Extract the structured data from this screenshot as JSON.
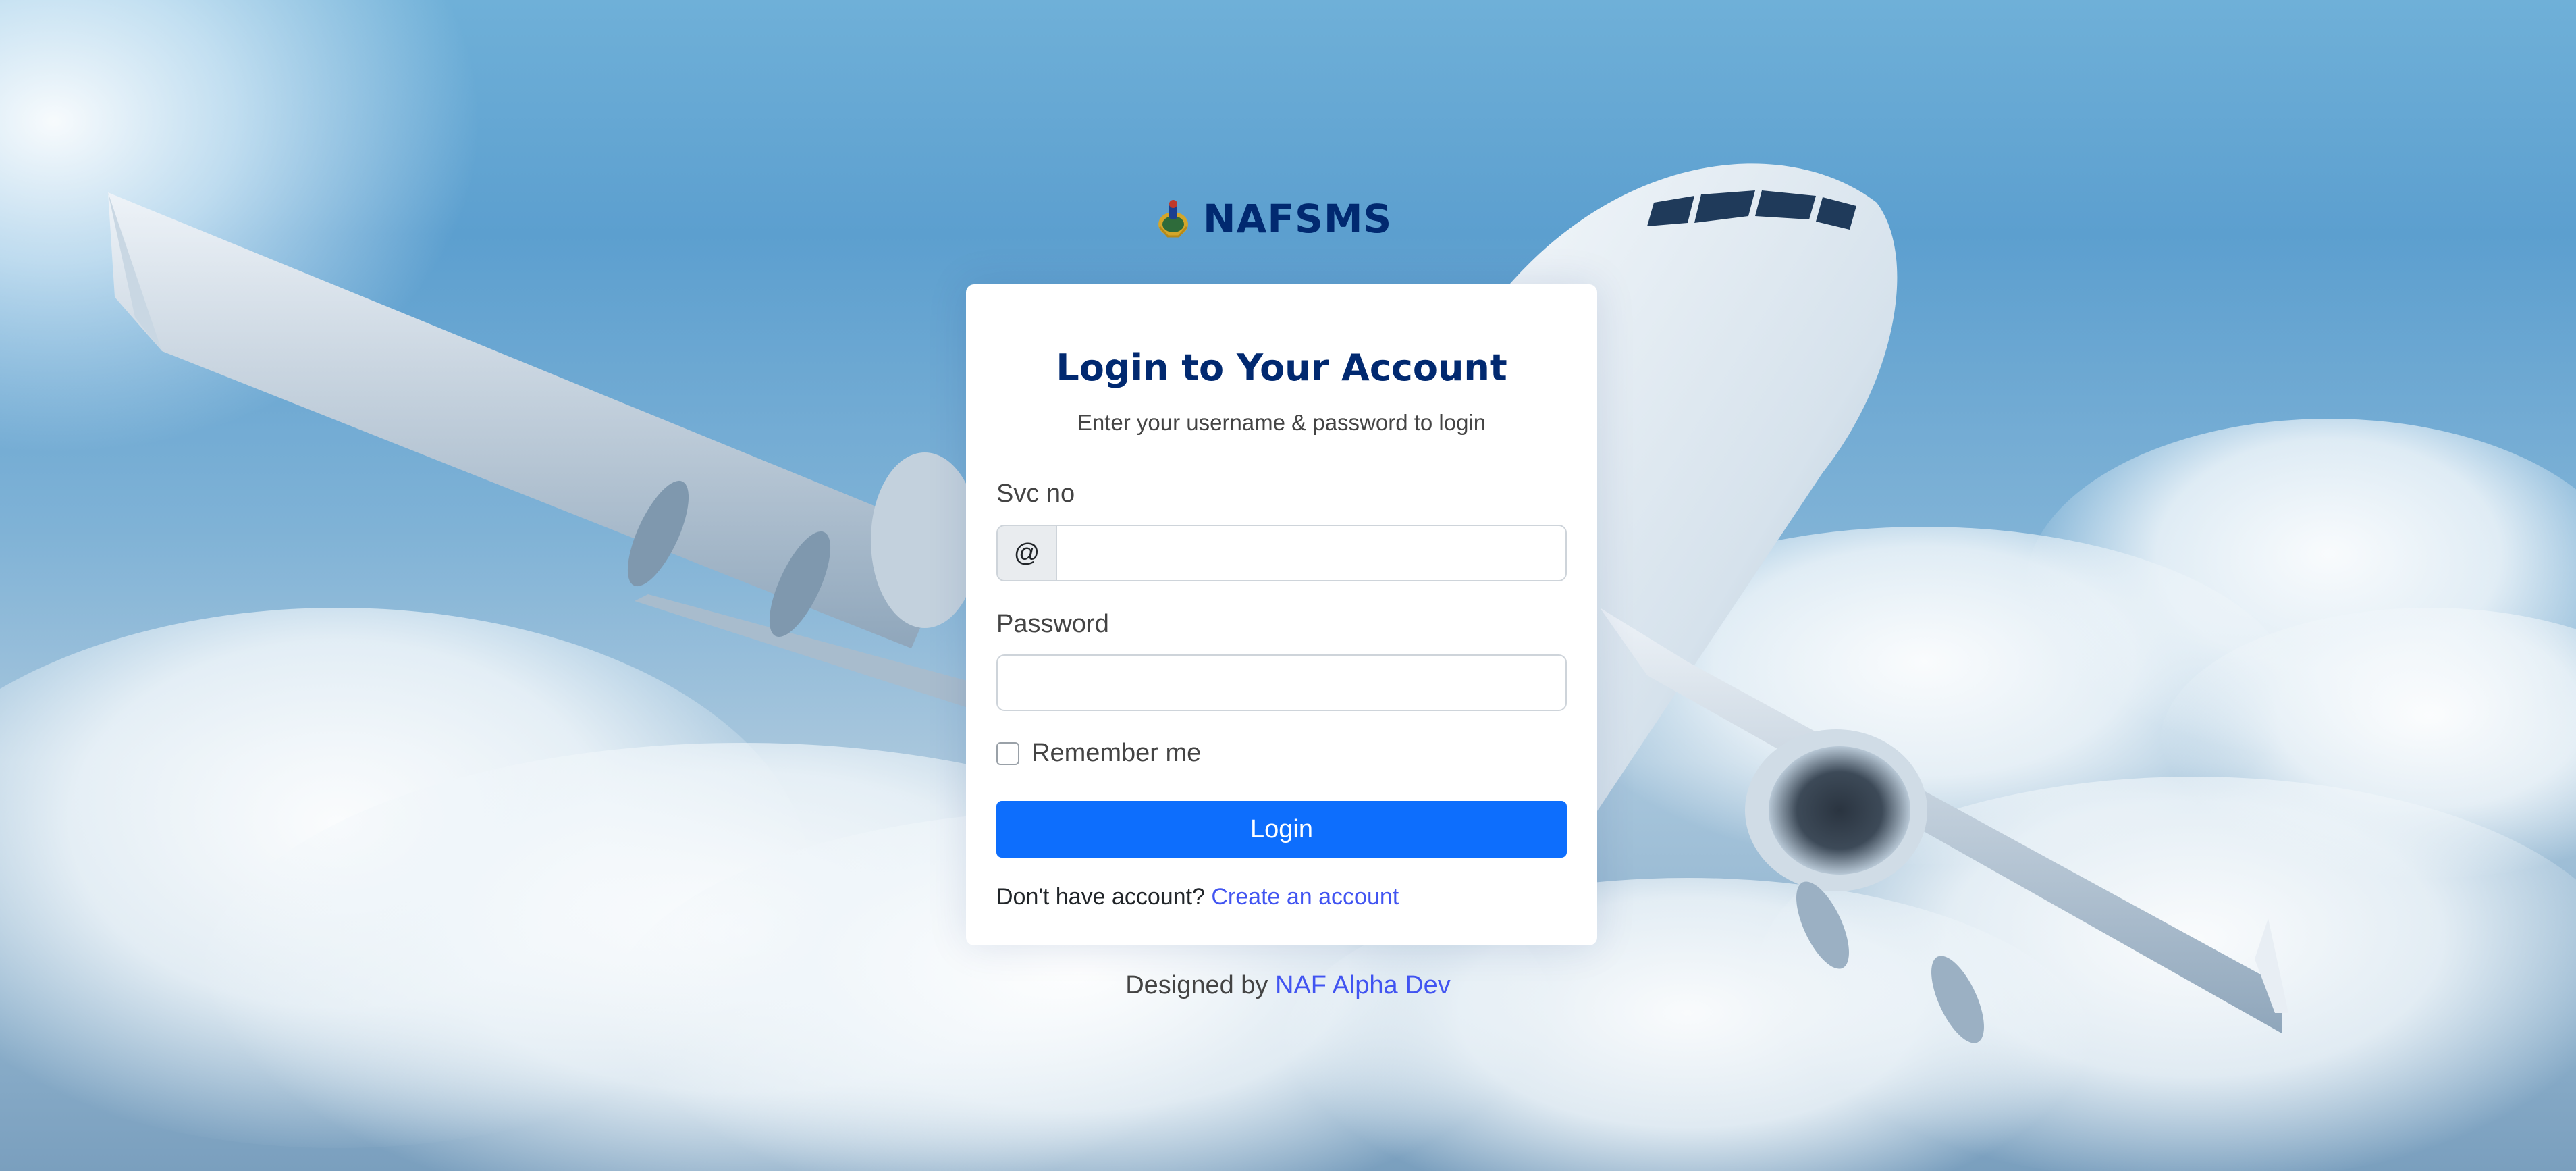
{
  "brand": {
    "name": "NAFSMS",
    "logo_icon": "naf-crest-icon"
  },
  "login_card": {
    "title": "Login to Your Account",
    "subtitle": "Enter your username & password to login",
    "username": {
      "label": "Svc no",
      "prefix": "@",
      "value": ""
    },
    "password": {
      "label": "Password",
      "value": ""
    },
    "remember_me": {
      "label": "Remember me",
      "checked": false
    },
    "login_button": "Login",
    "signup_prompt": "Don't have account?",
    "signup_link": "Create an account"
  },
  "footer": {
    "credits_prefix": "Designed by",
    "credits_link": "NAF Alpha Dev"
  },
  "colors": {
    "brand": "#012970",
    "primary_button": "#0d6efd",
    "link": "#4154f1"
  }
}
